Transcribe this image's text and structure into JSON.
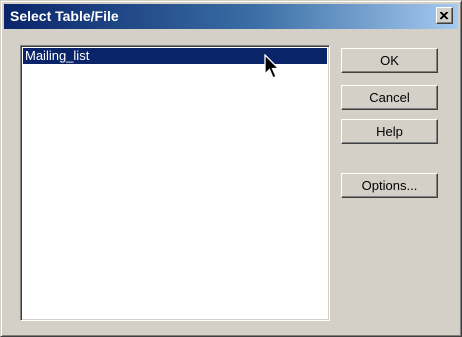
{
  "dialog": {
    "title": "Select Table/File",
    "close_icon": "close-icon"
  },
  "list": {
    "items": [
      {
        "label": "Mailing_list",
        "selected": true
      }
    ]
  },
  "buttons": {
    "ok": "OK",
    "cancel": "Cancel",
    "help": "Help",
    "options": "Options..."
  },
  "colors": {
    "titlebar_start": "#0a246a",
    "titlebar_end": "#a6caf0",
    "selection": "#0a246a",
    "face": "#d4d0c8"
  }
}
